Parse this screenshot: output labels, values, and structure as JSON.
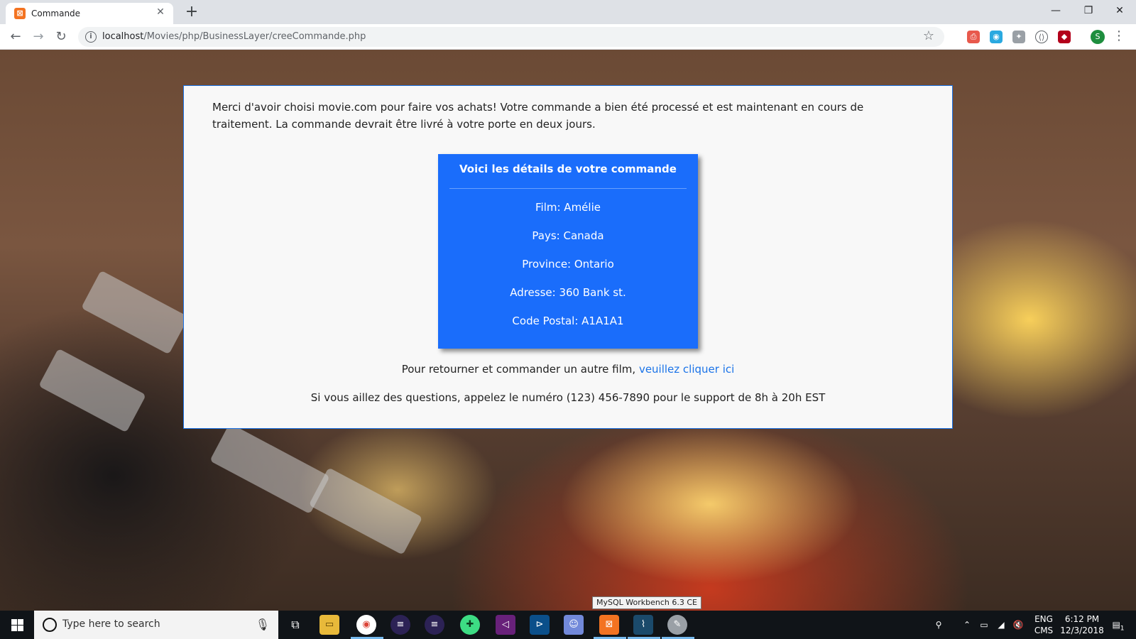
{
  "browser": {
    "tab_title": "Commande",
    "tab_close": "✕",
    "new_tab": "+",
    "url_host": "localhost",
    "url_path": "/Movies/php/BusinessLayer/creeCommande.php",
    "avatar_letter": "S",
    "window_controls": {
      "minimize": "—",
      "restore": "❐",
      "close": "✕"
    }
  },
  "page": {
    "intro": "Merci d'avoir choisi movie.com pour faire vos achats! Votre commande a bien été processé et est maintenant en cours de traitement. La commande devrait être livré à votre porte en deux jours.",
    "details": {
      "title": "Voici les détails de votre commande",
      "film": "Film: Amélie",
      "pays": "Pays: Canada",
      "province": "Province: Ontario",
      "adresse": "Adresse: 360 Bank st.",
      "code_postal": "Code Postal: A1A1A1"
    },
    "return_text": "Pour retourner et commander un autre film, ",
    "return_link": "veuillez cliquer ici",
    "support_text": "Si vous aillez des questions, appelez le numéro (123) 456-7890 pour le support de 8h à 20h EST"
  },
  "tooltip": "MySQL Workbench 6.3 CE",
  "taskbar": {
    "search_placeholder": "Type here to search",
    "lang_top": "ENG",
    "lang_bottom": "CMS",
    "time": "6:12 PM",
    "date": "12/3/2018",
    "notification_count": "1"
  },
  "colors": {
    "accent": "#1a73e8",
    "details_box": "#1a6dfb",
    "taskbar": "#101418"
  }
}
